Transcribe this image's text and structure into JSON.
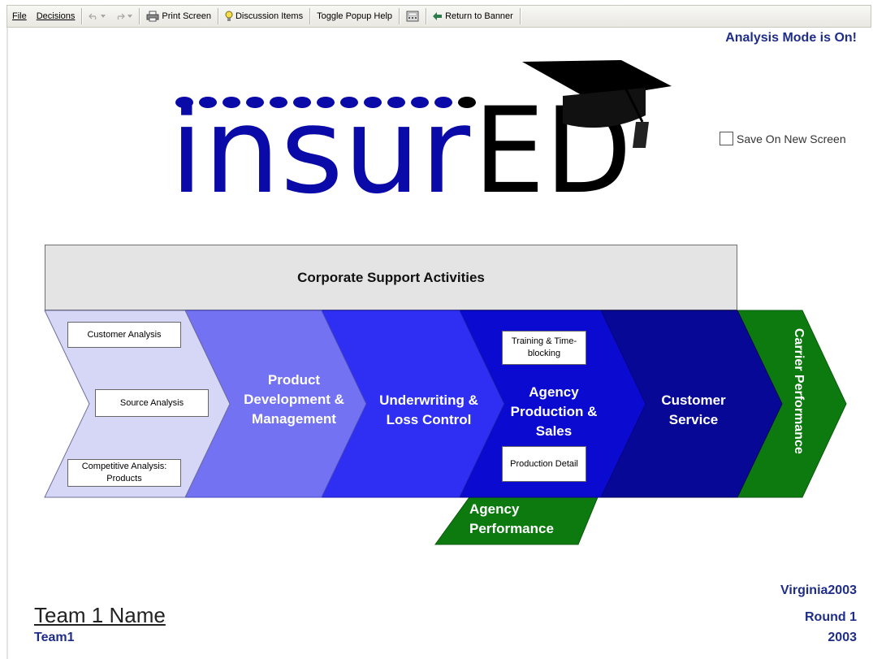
{
  "toolbar": {
    "file": "File",
    "decisions": "Decisions",
    "print_screen": "Print Screen",
    "discussion_items": "Discussion Items",
    "toggle_popup_help": "Toggle Popup Help",
    "return_to_banner": "Return to Banner"
  },
  "header": {
    "analysis_mode": "Analysis Mode is On!",
    "save_on_new_screen": "Save On New Screen",
    "logo_part1": "insur",
    "logo_part2": "ED"
  },
  "diagram": {
    "corporate_support": "Corporate Support Activities",
    "customer_analysis": "Customer Analysis",
    "source_analysis": "Source Analysis",
    "competitive_analysis_1": "Competitive Analysis:",
    "competitive_analysis_2": "Products",
    "product_dev_1": "Product",
    "product_dev_2": "Development &",
    "product_dev_3": "Management",
    "underwriting_1": "Underwriting &",
    "underwriting_2": "Loss Control",
    "agency_prod_1": "Agency",
    "agency_prod_2": "Production &",
    "agency_prod_3": "Sales",
    "training_1": "Training & Time-",
    "training_2": "blocking",
    "production_detail": "Production Detail",
    "customer_service_1": "Customer",
    "customer_service_2": "Service",
    "carrier_performance": "Carrier Performance",
    "agency_performance_1": "Agency",
    "agency_performance_2": "Performance"
  },
  "footer": {
    "team_name": "Team 1 Name",
    "team_id": "Team1",
    "scenario": "Virginia2003",
    "round": "Round 1",
    "year": "2003"
  },
  "colors": {
    "stage1": "#d6d7f7",
    "stage2": "#7272f2",
    "stage3": "#2f2ff3",
    "stage4": "#0a0ad0",
    "stage5": "#080896",
    "green": "#0d7a10",
    "logo_blue": "#0a0aa8",
    "text_blue": "#1f2d8a"
  }
}
